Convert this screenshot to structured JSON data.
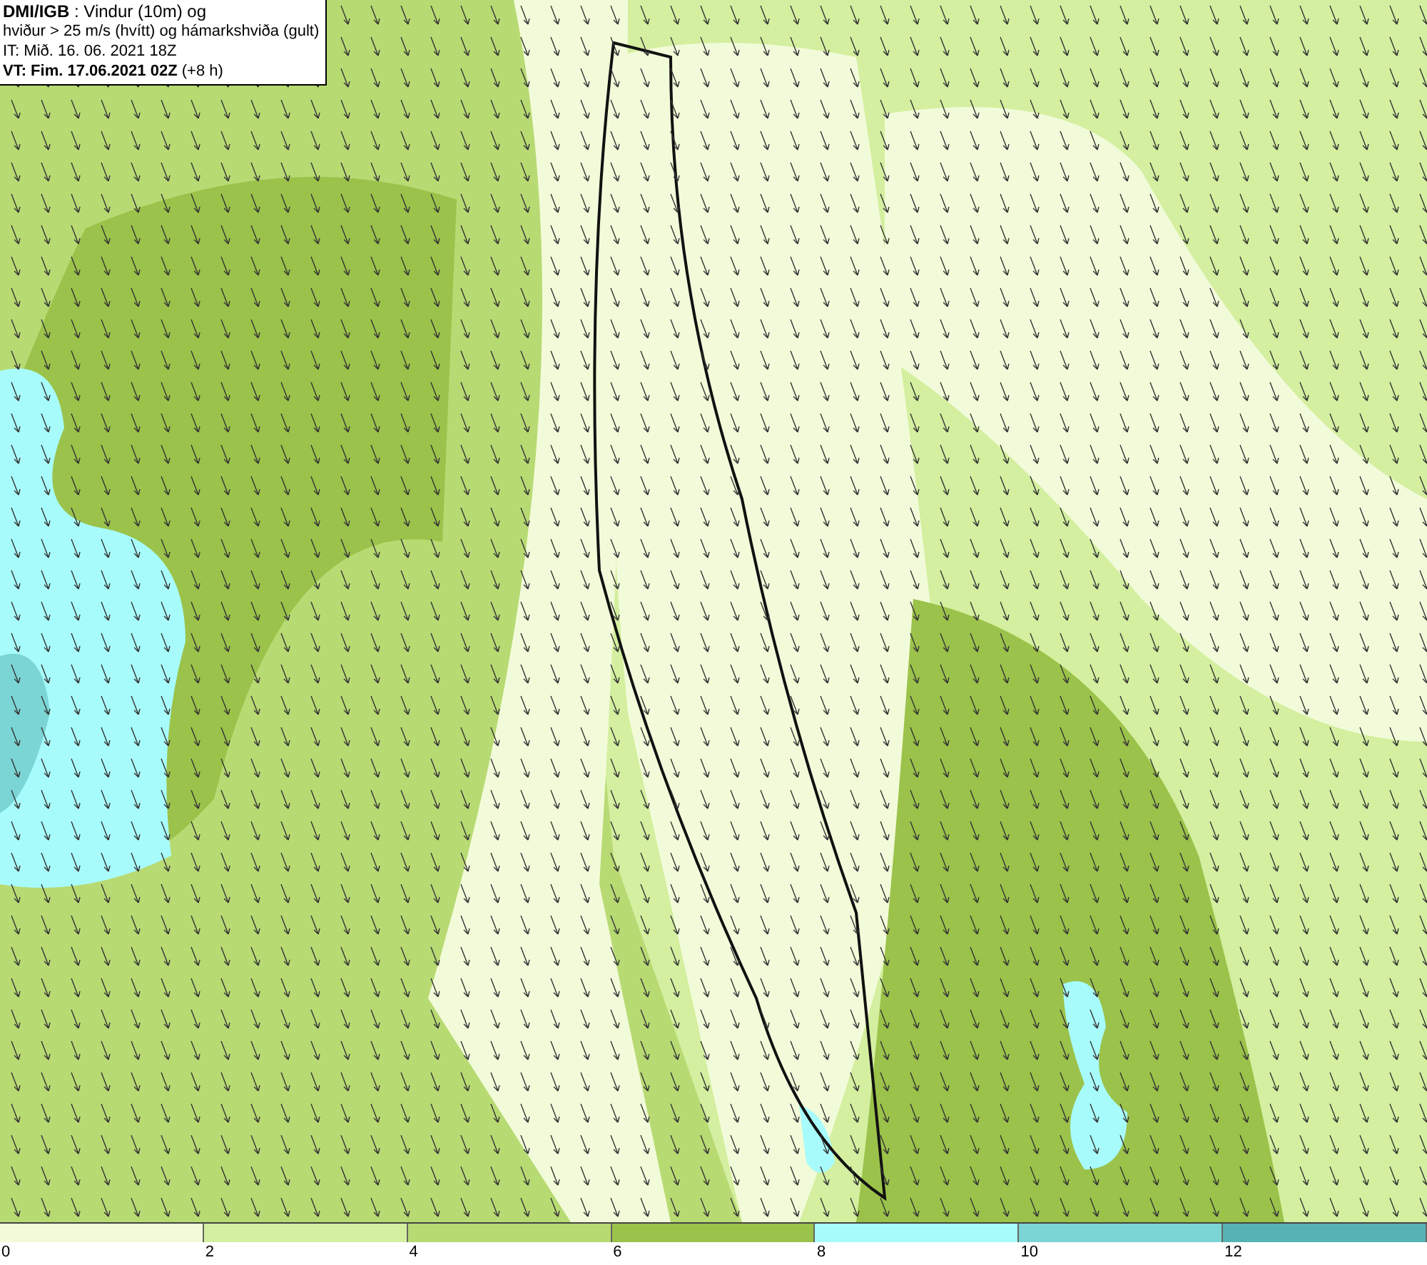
{
  "header": {
    "lines": [
      "**DMI/IGB** : Vindur (10m) og",
      "hviður > 25 m/s (hvítt) og hámarkshviða (gult)",
      "IT: Mið. 16. 06. 2021 18Z",
      "**VT: Fim. 17.06.2021 02Z** (+8 h)"
    ]
  },
  "legend": [
    {
      "label": "0",
      "color": "#f2fbd9"
    },
    {
      "label": "2",
      "color": "#d3ef9f"
    },
    {
      "label": "4",
      "color": "#b8da73"
    },
    {
      "label": "6",
      "color": "#9bc24a"
    },
    {
      "label": "8",
      "color": "#a8fbfb"
    },
    {
      "label": "10",
      "color": "#7cd5d5"
    },
    {
      "label": "12",
      "color": "#57b3b3"
    }
  ]
}
